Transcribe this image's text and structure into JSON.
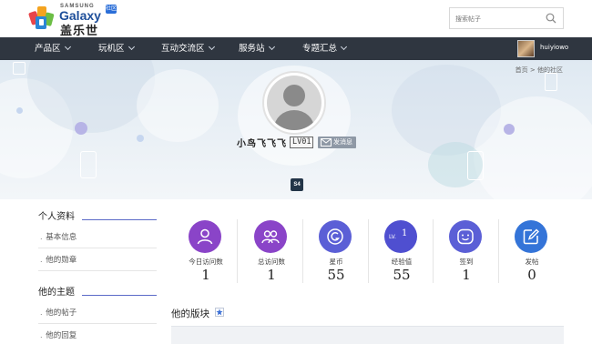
{
  "header": {
    "logo": {
      "brand_top": "SAMSUNG",
      "brand_main": "Galaxy",
      "brand_cn": "盖乐世",
      "badge": "社区"
    },
    "search": {
      "placeholder": "搜索帖子"
    }
  },
  "nav": {
    "items": [
      {
        "label": "产品区"
      },
      {
        "label": "玩机区"
      },
      {
        "label": "互动交流区"
      },
      {
        "label": "服务站"
      },
      {
        "label": "专题汇总"
      }
    ],
    "user": {
      "name": "huiyiowo"
    }
  },
  "banner": {
    "breadcrumb": "首页 > 他的社区",
    "username": "小鸟飞飞飞",
    "level": "LV01",
    "message_button": "发消息",
    "device_badge": "S4"
  },
  "sidebar": {
    "groups": [
      {
        "title": "个人资料",
        "items": [
          {
            "label": "基本信息"
          },
          {
            "label": "他的勋章"
          }
        ]
      },
      {
        "title": "他的主题",
        "items": [
          {
            "label": "他的帖子"
          },
          {
            "label": "他的回复"
          }
        ]
      }
    ]
  },
  "stats": [
    {
      "label": "今日访问数",
      "value": "1",
      "color": "#8a44c8",
      "icon": "person-icon"
    },
    {
      "label": "总访问数",
      "value": "1",
      "color": "#8a44c8",
      "icon": "people-icon"
    },
    {
      "label": "星币",
      "value": "55",
      "color": "#5b5fd6",
      "icon": "coin-icon"
    },
    {
      "label": "经验值",
      "value": "55",
      "color": "#4f4fd0",
      "icon": "level-icon",
      "icon_text": "LV.",
      "icon_num": "1"
    },
    {
      "label": "签到",
      "value": "1",
      "color": "#5b5fd6",
      "icon": "smile-icon"
    },
    {
      "label": "发帖",
      "value": "0",
      "color": "#3474d8",
      "icon": "edit-icon"
    }
  ],
  "section": {
    "title": "他的版块"
  }
}
